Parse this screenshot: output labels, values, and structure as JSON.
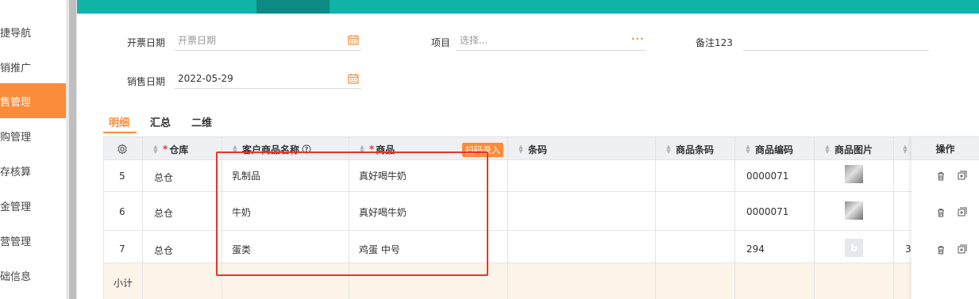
{
  "sidebar": {
    "items": [
      {
        "label": "快捷导航"
      },
      {
        "label": "营销推广"
      },
      {
        "label": "销售管理"
      },
      {
        "label": "采购管理"
      },
      {
        "label": "库存核算"
      },
      {
        "label": "资金管理"
      },
      {
        "label": "经营管理"
      },
      {
        "label": "基础信息"
      }
    ],
    "active_index": 2
  },
  "form": {
    "invoice_date_label": "开票日期",
    "invoice_date_placeholder": "开票日期",
    "project_label": "项目",
    "project_placeholder": "选择...",
    "remark_label": "备注123",
    "remark_value": "",
    "sale_date_label": "销售日期",
    "sale_date_value": "2022-05-29"
  },
  "subtabs": [
    "明细",
    "汇总",
    "二维"
  ],
  "table": {
    "headers": {
      "warehouse": "仓库",
      "customer_product": "客户商品名称",
      "product": "商品",
      "scan_entry": "扫码录入",
      "barcode": "条码",
      "product_barcode": "商品条码",
      "product_code": "商品编码",
      "product_image": "商品图片",
      "operation": "操作"
    },
    "rows": [
      {
        "no": "5",
        "warehouse": "总仓",
        "customer_product": "乳制品",
        "product": "真好喝牛奶",
        "product_code": "0000071",
        "image": "photo"
      },
      {
        "no": "6",
        "warehouse": "总仓",
        "customer_product": "牛奶",
        "product": "真好喝牛奶",
        "product_code": "0000071",
        "image": "photo"
      },
      {
        "no": "7",
        "warehouse": "总仓",
        "customer_product": "蛋类",
        "product": "鸡蛋 中号",
        "product_code": "294",
        "image": "placeholder",
        "extra": "3"
      }
    ],
    "subtotal_label": "小计"
  }
}
